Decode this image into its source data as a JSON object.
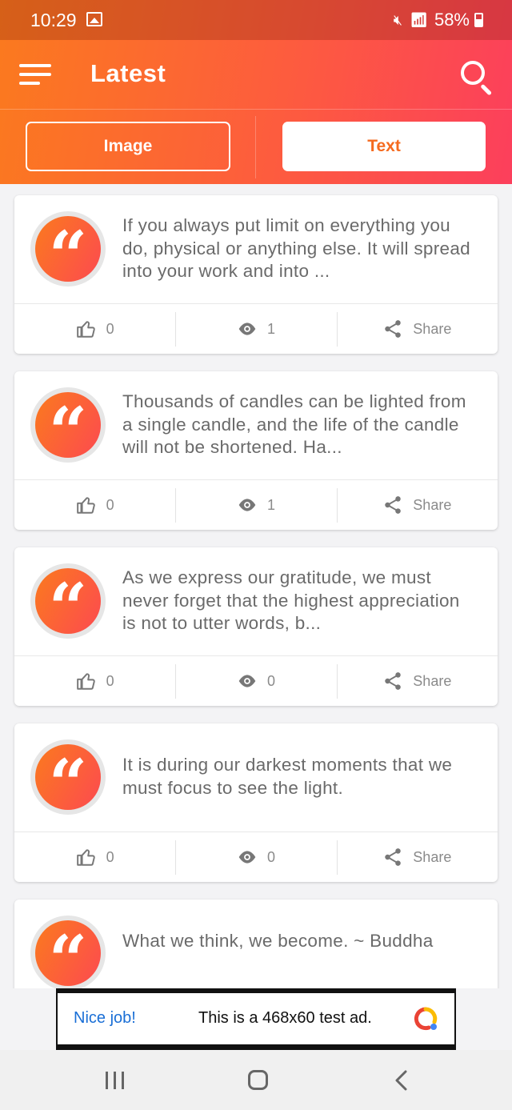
{
  "status_bar": {
    "time": "10:29",
    "battery": "58%",
    "icons": [
      "gallery-icon",
      "mute-icon",
      "wifi-icon",
      "signal-icon",
      "signal-icon",
      "battery-icon"
    ]
  },
  "app_bar": {
    "title": "Latest"
  },
  "tabs": [
    {
      "label": "Image",
      "selected": false
    },
    {
      "label": "Text",
      "selected": true
    }
  ],
  "quotes": [
    {
      "text": "If you always put limit on everything you do, physical or anything else. It will spread into your work and into ...",
      "likes": "0",
      "views": "1",
      "share_label": "Share"
    },
    {
      "text": "Thousands of candles can be lighted from a single candle, and the life of the candle will not be shortened. Ha...",
      "likes": "0",
      "views": "1",
      "share_label": "Share"
    },
    {
      "text": "As we express our gratitude, we must never forget that the highest appreciation is not to utter words, b...",
      "likes": "0",
      "views": "0",
      "share_label": "Share"
    },
    {
      "text": "It is during our darkest moments that we must focus to see the light.",
      "likes": "0",
      "views": "0",
      "share_label": "Share"
    },
    {
      "text": "What we think, we become. ~ Buddha",
      "likes": "",
      "views": "",
      "share_label": ""
    }
  ],
  "ad": {
    "title": "Nice job!",
    "text": "This is a 468x60 test ad."
  },
  "colors": {
    "accent_start": "#fb7a1e",
    "accent_end": "#fc3f5c",
    "ad_link": "#1a6fd6"
  }
}
